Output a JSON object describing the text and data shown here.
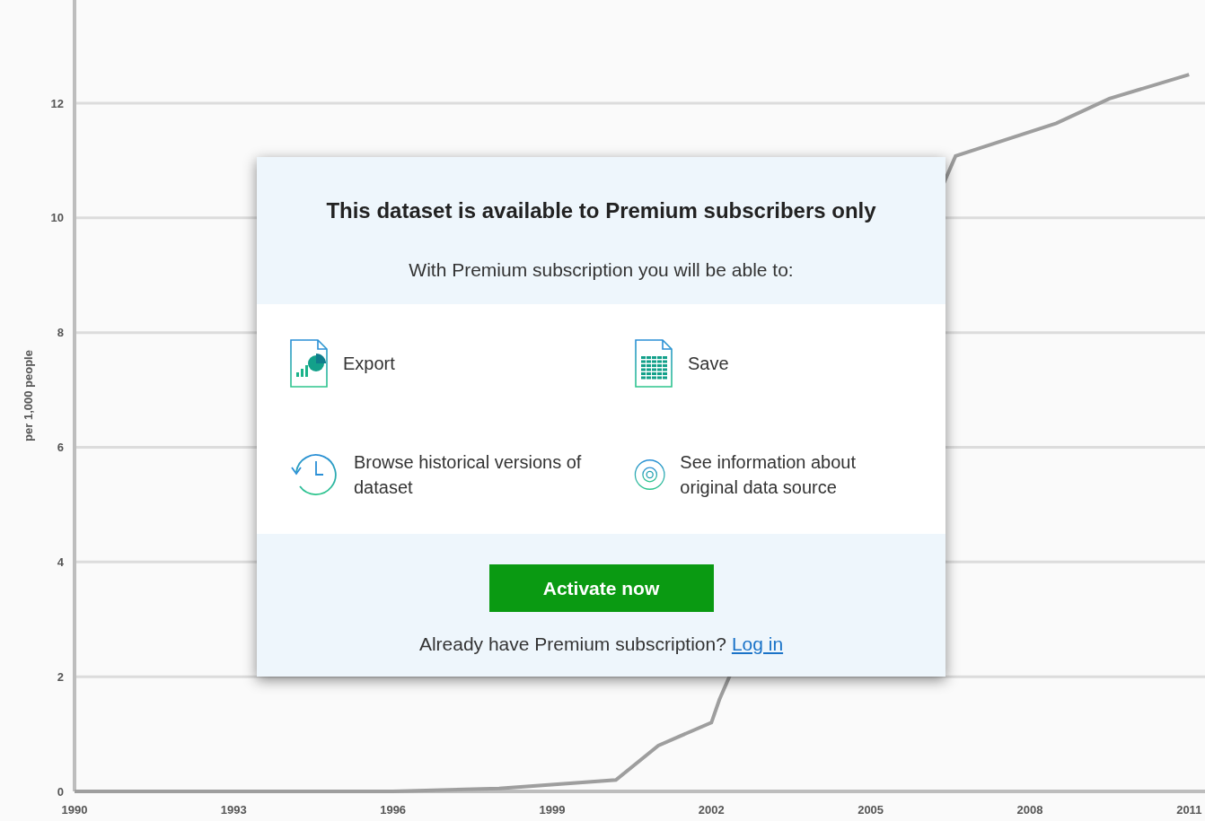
{
  "chart": {
    "chart_data": {
      "type": "line",
      "ylabel": "per 1,000 people",
      "x": [
        1990,
        1993,
        1996,
        1998,
        2000.2,
        2001,
        2002,
        2002.15,
        2006.6,
        2008.5,
        2009.5,
        2011
      ],
      "series": [
        {
          "color": "#9e9e9e",
          "values": [
            0,
            0,
            0,
            0.05,
            0.2,
            0.8,
            1.2,
            1.6,
            11.08,
            11.65,
            12.08,
            12.5
          ]
        }
      ],
      "grid": true,
      "xlim": [
        1990,
        2011.3
      ],
      "ylim": [
        0,
        13.8
      ],
      "xticks": [
        1990,
        1993,
        1996,
        1999,
        2002,
        2005,
        2008,
        2011
      ],
      "yticks": [
        0,
        2,
        4,
        6,
        8,
        10,
        12
      ]
    }
  },
  "dialog": {
    "title": "This dataset is available to Premium subscribers only",
    "subtitle": "With Premium subscription you will be able to:",
    "features": [
      {
        "kind": "export",
        "label": "Export"
      },
      {
        "kind": "save",
        "label": "Save"
      },
      {
        "kind": "history",
        "label": "Browse historical versions of dataset"
      },
      {
        "kind": "source",
        "label": "See information about original data source"
      }
    ],
    "button": "Activate now",
    "login_prompt": "Already have Premium subscription?",
    "login_link": "Log in"
  }
}
